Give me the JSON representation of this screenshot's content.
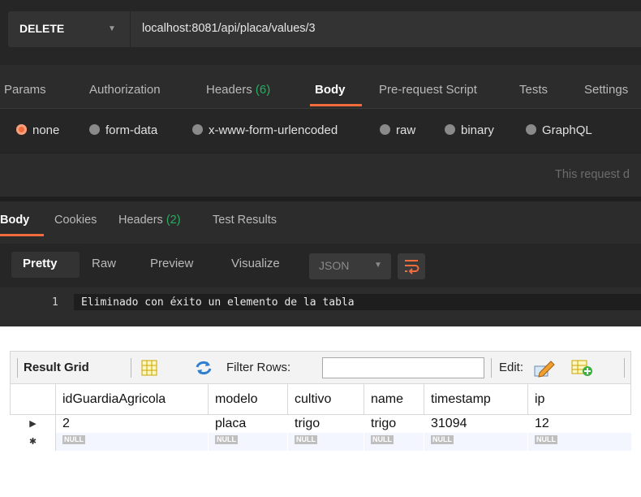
{
  "request": {
    "method": "DELETE",
    "url": "localhost:8081/api/placa/values/3"
  },
  "request_tabs": [
    {
      "label": "Params",
      "count": ""
    },
    {
      "label": "Authorization",
      "count": ""
    },
    {
      "label": "Headers",
      "count": "(6)"
    },
    {
      "label": "Body",
      "count": ""
    },
    {
      "label": "Pre-request Script",
      "count": ""
    },
    {
      "label": "Tests",
      "count": ""
    },
    {
      "label": "Settings",
      "count": ""
    }
  ],
  "active_request_tab": "Body",
  "body_options": [
    "none",
    "form-data",
    "x-www-form-urlencoded",
    "raw",
    "binary",
    "GraphQL"
  ],
  "selected_body_option": "none",
  "body_hint": "This request d",
  "response_tabs": [
    {
      "label": "Body",
      "count": ""
    },
    {
      "label": "Cookies",
      "count": ""
    },
    {
      "label": "Headers",
      "count": "(2)"
    },
    {
      "label": "Test Results",
      "count": ""
    }
  ],
  "response_tools": [
    "Pretty",
    "Raw",
    "Preview",
    "Visualize"
  ],
  "format_select": "JSON",
  "code_lines": [
    {
      "n": "1",
      "text": "Eliminado con éxito un elemento de la tabla"
    }
  ],
  "workbench": {
    "result_grid_label": "Result Grid",
    "filter_label": "Filter Rows:",
    "edit_label": "Edit:",
    "columns": [
      "idGuardiaAgricola",
      "modelo",
      "cultivo",
      "name",
      "timestamp",
      "ip"
    ],
    "rows": [
      [
        "2",
        "placa",
        "trigo",
        "trigo",
        "31094",
        "12"
      ]
    ],
    "null_label": "NULL"
  },
  "colors": {
    "accent": "#f26b3a",
    "count_green": "#27ae60",
    "null_badge": "#bfbfbf"
  }
}
